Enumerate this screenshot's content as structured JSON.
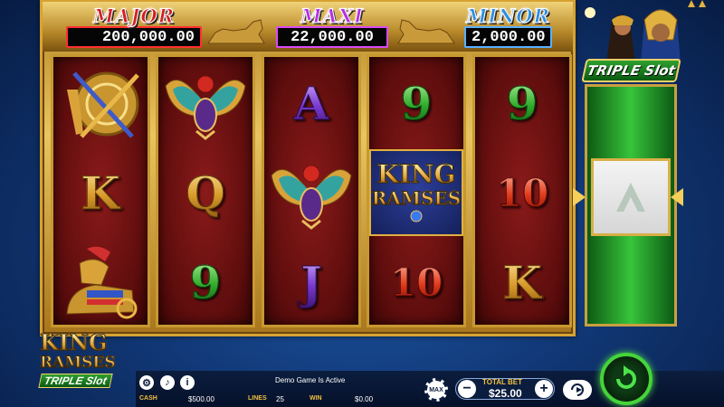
{
  "jackpots": {
    "major": {
      "title": "MAJOR",
      "value": "200,000.00"
    },
    "maxi": {
      "title": "MAXI",
      "value": "22,000.00"
    },
    "minor": {
      "title": "MINOR",
      "value": "2,000.00"
    }
  },
  "reels": [
    [
      "crossed-staff-shield",
      "K",
      "chariot-horse"
    ],
    [
      "scarab",
      "Q",
      "9"
    ],
    [
      "A",
      "scarab",
      "J"
    ],
    [
      "9",
      "king-ramses-wild",
      "10"
    ],
    [
      "9",
      "10",
      "K"
    ]
  ],
  "wild_tile": {
    "line1": "KING",
    "line2": "RAMSES"
  },
  "side_reel": {
    "logo": "TRIPLE Slot"
  },
  "game_logo": {
    "line1": "KING",
    "line2": "RAMSES",
    "line3": "TRIPLE Slot"
  },
  "hud": {
    "demo_text": "Demo Game Is Active",
    "cash_label": "CASH",
    "cash_value": "$500.00",
    "lines_label": "LINES",
    "lines_value": "25",
    "win_label": "WIN",
    "win_value": "$0.00",
    "max_label": "MAX",
    "total_bet_label": "TOTAL BET",
    "total_bet_value": "$25.00",
    "minus": "−",
    "plus": "+",
    "info": "i"
  },
  "colors": {
    "major": "#d32020",
    "maxi": "#b530e0",
    "minor": "#2f8ee0",
    "spin": "#45d43a"
  }
}
